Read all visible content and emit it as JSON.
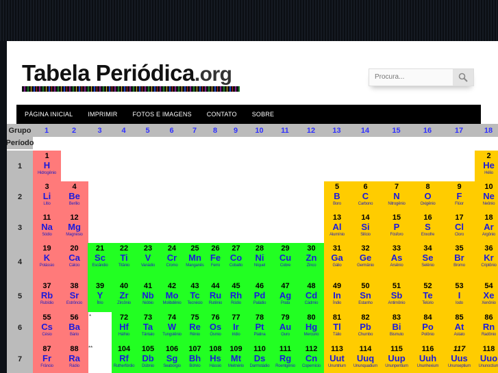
{
  "site": {
    "logo_main": "Tabela Periódica",
    "logo_suffix": ".org",
    "search_placeholder": "Procura..."
  },
  "nav": [
    "PÁGINA INICIAL",
    "IMPRIMIR",
    "FOTOS E IMAGENS",
    "CONTATO",
    "SOBRE"
  ],
  "table": {
    "group_label": "Grupo",
    "period_label": "Período",
    "groups": [
      "1",
      "2",
      "3",
      "4",
      "5",
      "6",
      "7",
      "8",
      "9",
      "10",
      "11",
      "12",
      "13",
      "14",
      "15",
      "16",
      "17",
      "18"
    ],
    "periods": [
      "1",
      "2",
      "3",
      "4",
      "5",
      "6",
      "7"
    ],
    "lanthanide_mark": "*",
    "actinide_mark": "**",
    "elements": [
      {
        "n": "1",
        "s": "H",
        "name": "Hidrogênio",
        "g": 1,
        "p": 1,
        "c": "alk"
      },
      {
        "n": "2",
        "s": "He",
        "name": "Hélio",
        "g": 18,
        "p": 1,
        "c": "ot"
      },
      {
        "n": "3",
        "s": "Li",
        "name": "Lítio",
        "g": 1,
        "p": 2,
        "c": "alk"
      },
      {
        "n": "4",
        "s": "Be",
        "name": "Berílio",
        "g": 2,
        "p": 2,
        "c": "ae"
      },
      {
        "n": "5",
        "s": "B",
        "name": "Boro",
        "g": 13,
        "p": 2,
        "c": "ot"
      },
      {
        "n": "6",
        "s": "C",
        "name": "Carbono",
        "g": 14,
        "p": 2,
        "c": "ot"
      },
      {
        "n": "7",
        "s": "N",
        "name": "Nitrogênio",
        "g": 15,
        "p": 2,
        "c": "ot"
      },
      {
        "n": "8",
        "s": "O",
        "name": "Oxigênio",
        "g": 16,
        "p": 2,
        "c": "ot"
      },
      {
        "n": "9",
        "s": "F",
        "name": "Flúor",
        "g": 17,
        "p": 2,
        "c": "ot"
      },
      {
        "n": "10",
        "s": "Ne",
        "name": "Neônio",
        "g": 18,
        "p": 2,
        "c": "ot"
      },
      {
        "n": "11",
        "s": "Na",
        "name": "Sódio",
        "g": 1,
        "p": 3,
        "c": "alk"
      },
      {
        "n": "12",
        "s": "Mg",
        "name": "Magnésio",
        "g": 2,
        "p": 3,
        "c": "ae"
      },
      {
        "n": "13",
        "s": "Al",
        "name": "Alumínio",
        "g": 13,
        "p": 3,
        "c": "ot"
      },
      {
        "n": "14",
        "s": "Si",
        "name": "Silício",
        "g": 14,
        "p": 3,
        "c": "ot"
      },
      {
        "n": "15",
        "s": "P",
        "name": "Fósforo",
        "g": 15,
        "p": 3,
        "c": "ot"
      },
      {
        "n": "16",
        "s": "S",
        "name": "Enxofre",
        "g": 16,
        "p": 3,
        "c": "ot"
      },
      {
        "n": "17",
        "s": "Cl",
        "name": "Cloro",
        "g": 17,
        "p": 3,
        "c": "ot"
      },
      {
        "n": "18",
        "s": "Ar",
        "name": "Argônio",
        "g": 18,
        "p": 3,
        "c": "ot"
      },
      {
        "n": "19",
        "s": "K",
        "name": "Potássio",
        "g": 1,
        "p": 4,
        "c": "alk"
      },
      {
        "n": "20",
        "s": "Ca",
        "name": "Cálcio",
        "g": 2,
        "p": 4,
        "c": "ae"
      },
      {
        "n": "21",
        "s": "Sc",
        "name": "Escândio",
        "g": 3,
        "p": 4,
        "c": "tm"
      },
      {
        "n": "22",
        "s": "Ti",
        "name": "Titânio",
        "g": 4,
        "p": 4,
        "c": "tm"
      },
      {
        "n": "23",
        "s": "V",
        "name": "Vanádio",
        "g": 5,
        "p": 4,
        "c": "tm"
      },
      {
        "n": "24",
        "s": "Cr",
        "name": "Cromo",
        "g": 6,
        "p": 4,
        "c": "tm"
      },
      {
        "n": "25",
        "s": "Mn",
        "name": "Manganês",
        "g": 7,
        "p": 4,
        "c": "tm"
      },
      {
        "n": "26",
        "s": "Fe",
        "name": "Ferro",
        "g": 8,
        "p": 4,
        "c": "tm"
      },
      {
        "n": "27",
        "s": "Co",
        "name": "Cobalto",
        "g": 9,
        "p": 4,
        "c": "tm"
      },
      {
        "n": "28",
        "s": "Ni",
        "name": "Níquel",
        "g": 10,
        "p": 4,
        "c": "tm"
      },
      {
        "n": "29",
        "s": "Cu",
        "name": "Cobre",
        "g": 11,
        "p": 4,
        "c": "tm"
      },
      {
        "n": "30",
        "s": "Zn",
        "name": "Zinco",
        "g": 12,
        "p": 4,
        "c": "tm"
      },
      {
        "n": "31",
        "s": "Ga",
        "name": "Gálio",
        "g": 13,
        "p": 4,
        "c": "ot"
      },
      {
        "n": "32",
        "s": "Ge",
        "name": "Germânio",
        "g": 14,
        "p": 4,
        "c": "ot"
      },
      {
        "n": "33",
        "s": "As",
        "name": "Arsênio",
        "g": 15,
        "p": 4,
        "c": "ot"
      },
      {
        "n": "34",
        "s": "Se",
        "name": "Selênio",
        "g": 16,
        "p": 4,
        "c": "ot"
      },
      {
        "n": "35",
        "s": "Br",
        "name": "Bromo",
        "g": 17,
        "p": 4,
        "c": "ot"
      },
      {
        "n": "36",
        "s": "Kr",
        "name": "Criptônio",
        "g": 18,
        "p": 4,
        "c": "ot"
      },
      {
        "n": "37",
        "s": "Rb",
        "name": "Rubídio",
        "g": 1,
        "p": 5,
        "c": "alk"
      },
      {
        "n": "38",
        "s": "Sr",
        "name": "Estrôncio",
        "g": 2,
        "p": 5,
        "c": "ae"
      },
      {
        "n": "39",
        "s": "Y",
        "name": "Ítrio",
        "g": 3,
        "p": 5,
        "c": "tm"
      },
      {
        "n": "40",
        "s": "Zr",
        "name": "Zircônio",
        "g": 4,
        "p": 5,
        "c": "tm"
      },
      {
        "n": "41",
        "s": "Nb",
        "name": "Nióbio",
        "g": 5,
        "p": 5,
        "c": "tm"
      },
      {
        "n": "42",
        "s": "Mo",
        "name": "Molibdênio",
        "g": 6,
        "p": 5,
        "c": "tm"
      },
      {
        "n": "43",
        "s": "Tc",
        "name": "Tecnécio",
        "g": 7,
        "p": 5,
        "c": "tm"
      },
      {
        "n": "44",
        "s": "Ru",
        "name": "Rutênio",
        "g": 8,
        "p": 5,
        "c": "tm"
      },
      {
        "n": "45",
        "s": "Rh",
        "name": "Ródio",
        "g": 9,
        "p": 5,
        "c": "tm"
      },
      {
        "n": "46",
        "s": "Pd",
        "name": "Paládio",
        "g": 10,
        "p": 5,
        "c": "tm"
      },
      {
        "n": "47",
        "s": "Ag",
        "name": "Prata",
        "g": 11,
        "p": 5,
        "c": "tm"
      },
      {
        "n": "48",
        "s": "Cd",
        "name": "Cádmio",
        "g": 12,
        "p": 5,
        "c": "tm"
      },
      {
        "n": "49",
        "s": "In",
        "name": "Índio",
        "g": 13,
        "p": 5,
        "c": "ot"
      },
      {
        "n": "50",
        "s": "Sn",
        "name": "Estanho",
        "g": 14,
        "p": 5,
        "c": "ot"
      },
      {
        "n": "51",
        "s": "Sb",
        "name": "Antimônio",
        "g": 15,
        "p": 5,
        "c": "ot"
      },
      {
        "n": "52",
        "s": "Te",
        "name": "Telúrio",
        "g": 16,
        "p": 5,
        "c": "ot"
      },
      {
        "n": "53",
        "s": "I",
        "name": "Iodo",
        "g": 17,
        "p": 5,
        "c": "ot"
      },
      {
        "n": "54",
        "s": "Xe",
        "name": "Xenônio",
        "g": 18,
        "p": 5,
        "c": "ot"
      },
      {
        "n": "55",
        "s": "Cs",
        "name": "Césio",
        "g": 1,
        "p": 6,
        "c": "alk"
      },
      {
        "n": "56",
        "s": "Ba",
        "name": "Bário",
        "g": 2,
        "p": 6,
        "c": "ae"
      },
      {
        "n": "72",
        "s": "Hf",
        "name": "Háfnio",
        "g": 4,
        "p": 6,
        "c": "tm"
      },
      {
        "n": "73",
        "s": "Ta",
        "name": "Tântalo",
        "g": 5,
        "p": 6,
        "c": "tm"
      },
      {
        "n": "74",
        "s": "W",
        "name": "Tungstênio",
        "g": 6,
        "p": 6,
        "c": "tm"
      },
      {
        "n": "75",
        "s": "Re",
        "name": "Rênio",
        "g": 7,
        "p": 6,
        "c": "tm"
      },
      {
        "n": "76",
        "s": "Os",
        "name": "Ósmio",
        "g": 8,
        "p": 6,
        "c": "tm"
      },
      {
        "n": "77",
        "s": "Ir",
        "name": "Irídio",
        "g": 9,
        "p": 6,
        "c": "tm"
      },
      {
        "n": "78",
        "s": "Pt",
        "name": "Platina",
        "g": 10,
        "p": 6,
        "c": "tm"
      },
      {
        "n": "79",
        "s": "Au",
        "name": "Ouro",
        "g": 11,
        "p": 6,
        "c": "tm"
      },
      {
        "n": "80",
        "s": "Hg",
        "name": "Mercúrio",
        "g": 12,
        "p": 6,
        "c": "tm"
      },
      {
        "n": "81",
        "s": "Tl",
        "name": "Tálio",
        "g": 13,
        "p": 6,
        "c": "ot"
      },
      {
        "n": "82",
        "s": "Pb",
        "name": "Chumbo",
        "g": 14,
        "p": 6,
        "c": "ot"
      },
      {
        "n": "83",
        "s": "Bi",
        "name": "Bismuto",
        "g": 15,
        "p": 6,
        "c": "ot"
      },
      {
        "n": "84",
        "s": "Po",
        "name": "Polônio",
        "g": 16,
        "p": 6,
        "c": "ot"
      },
      {
        "n": "85",
        "s": "At",
        "name": "Astato",
        "g": 17,
        "p": 6,
        "c": "ot"
      },
      {
        "n": "86",
        "s": "Rn",
        "name": "Radônio",
        "g": 18,
        "p": 6,
        "c": "ot"
      },
      {
        "n": "87",
        "s": "Fr",
        "name": "Frâncio",
        "g": 1,
        "p": 7,
        "c": "alk"
      },
      {
        "n": "88",
        "s": "Ra",
        "name": "Rádio",
        "g": 2,
        "p": 7,
        "c": "ae"
      },
      {
        "n": "104",
        "s": "Rf",
        "name": "Rutherfórdio",
        "g": 4,
        "p": 7,
        "c": "tm"
      },
      {
        "n": "105",
        "s": "Db",
        "name": "Dúbnio",
        "g": 5,
        "p": 7,
        "c": "tm"
      },
      {
        "n": "106",
        "s": "Sg",
        "name": "Seabórgio",
        "g": 6,
        "p": 7,
        "c": "tm"
      },
      {
        "n": "107",
        "s": "Bh",
        "name": "Bóhrio",
        "g": 7,
        "p": 7,
        "c": "tm"
      },
      {
        "n": "108",
        "s": "Hs",
        "name": "Hássio",
        "g": 8,
        "p": 7,
        "c": "tm"
      },
      {
        "n": "109",
        "s": "Mt",
        "name": "Meitnério",
        "g": 9,
        "p": 7,
        "c": "tm"
      },
      {
        "n": "110",
        "s": "Ds",
        "name": "Darmstádio",
        "g": 10,
        "p": 7,
        "c": "tm"
      },
      {
        "n": "111",
        "s": "Rg",
        "name": "Roentgênio",
        "g": 11,
        "p": 7,
        "c": "tm"
      },
      {
        "n": "112",
        "s": "Cn",
        "name": "Copernício",
        "g": 12,
        "p": 7,
        "c": "tm"
      },
      {
        "n": "113",
        "s": "Uut",
        "name": "Ununtrium",
        "g": 13,
        "p": 7,
        "c": "ot"
      },
      {
        "n": "114",
        "s": "Uuq",
        "name": "Ununquadium",
        "g": 14,
        "p": 7,
        "c": "ot"
      },
      {
        "n": "115",
        "s": "Uup",
        "name": "Ununpentium",
        "g": 15,
        "p": 7,
        "c": "ot"
      },
      {
        "n": "116",
        "s": "Uuh",
        "name": "Ununhexium",
        "g": 16,
        "p": 7,
        "c": "ot"
      },
      {
        "n": "117",
        "s": "Uus",
        "name": "Ununseptium",
        "g": 17,
        "p": 7,
        "c": "ot"
      },
      {
        "n": "118",
        "s": "Uuo",
        "name": "Ununoctium",
        "g": 18,
        "p": 7,
        "c": "ot"
      }
    ]
  },
  "colors": {
    "alkali": "#ff7a7a",
    "transition": "#22ff22",
    "other": "#ffcc00",
    "header": "#bbbbbb",
    "number_blue": "#3030ff"
  }
}
